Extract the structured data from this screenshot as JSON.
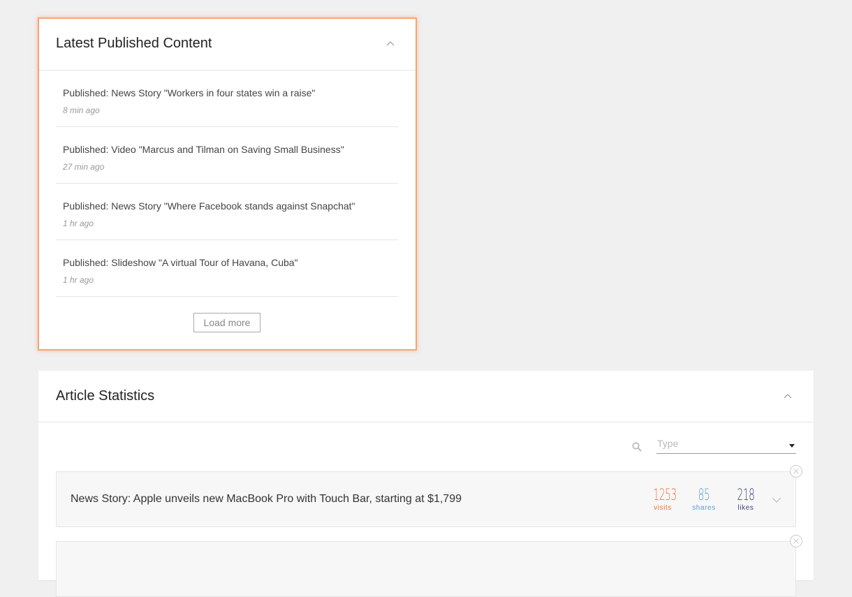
{
  "published": {
    "title": "Latest Published Content",
    "items": [
      {
        "title": "Published: News Story \"Workers in four states win a raise\"",
        "time": "8 min ago"
      },
      {
        "title": "Published: Video \"Marcus and Tilman on Saving Small Business\"",
        "time": "27 min ago"
      },
      {
        "title": "Published: News Story \"Where Facebook stands against Snapchat\"",
        "time": "1 hr ago"
      },
      {
        "title": "Published: Slideshow \"A virtual Tour of Havana, Cuba\"",
        "time": "1 hr ago"
      }
    ],
    "load_more_label": "Load more"
  },
  "stats": {
    "title": "Article Statistics",
    "type_placeholder": "Type",
    "articles": [
      {
        "title": "News Story: Apple unveils new MacBook Pro with Touch Bar, starting at $1,799",
        "visits": "1253",
        "visits_label": "visits",
        "shares": "85",
        "shares_label": "shares",
        "likes": "218",
        "likes_label": "likes"
      },
      {
        "title": "",
        "visits": "",
        "visits_label": "",
        "shares": "",
        "shares_label": "",
        "likes": "",
        "likes_label": ""
      }
    ]
  },
  "colors": {
    "highlight_border": "#f6a676",
    "visits": "#f0703c",
    "shares": "#5b9bd5",
    "likes": "#3b3f7a"
  },
  "icons": {
    "collapse": "chevron-up-icon",
    "expand": "chevron-down-icon",
    "search": "search-icon",
    "remove": "close-circle-icon",
    "dropdown": "caret-down-icon"
  }
}
